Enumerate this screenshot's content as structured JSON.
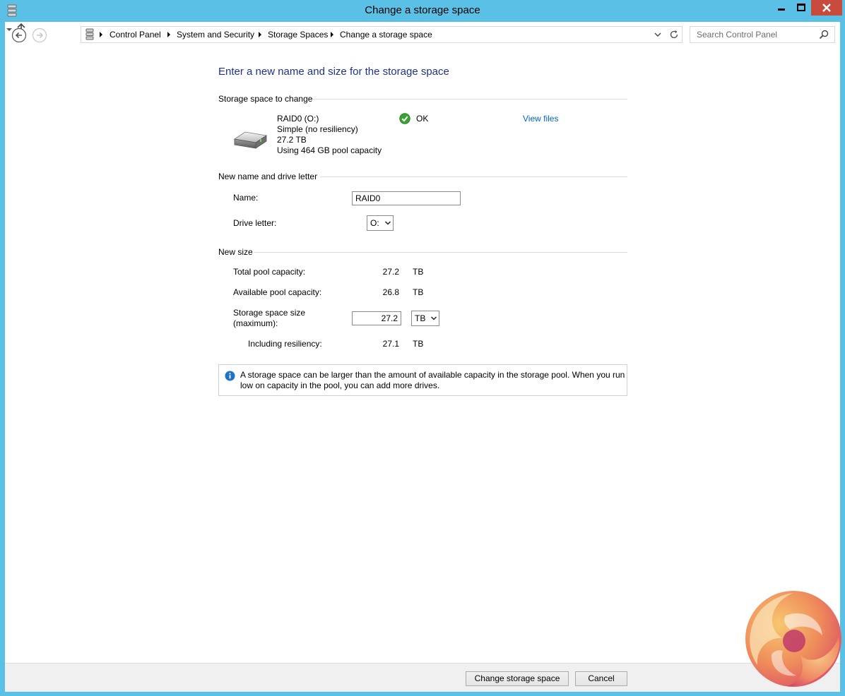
{
  "window": {
    "title": "Change a storage space"
  },
  "nav": {
    "breadcrumbs": [
      "Control Panel",
      "System and Security",
      "Storage Spaces",
      "Change a storage space"
    ],
    "search_placeholder": "Search Control Panel"
  },
  "page": {
    "heading": "Enter a new name and size for the storage space",
    "sections": {
      "space_to_change": "Storage space to change",
      "name_and_letter": "New name and drive letter",
      "new_size": "New size"
    },
    "space": {
      "name": "RAID0 (O:)",
      "type": "Simple (no resiliency)",
      "size": "27.2 TB",
      "usage": "Using 464 GB pool capacity",
      "status": "OK",
      "view_files": "View files"
    },
    "form": {
      "name_label": "Name:",
      "name_value": "RAID0",
      "drive_letter_label": "Drive letter:",
      "drive_letter_value": "O:",
      "total_label": "Total pool capacity:",
      "total_value": "27.2",
      "total_unit": "TB",
      "available_label": "Available pool capacity:",
      "available_value": "26.8",
      "available_unit": "TB",
      "size_label_1": "Storage space size",
      "size_label_2": "(maximum):",
      "size_value": "27.2",
      "size_unit": "TB",
      "resiliency_label": "Including resiliency:",
      "resiliency_value": "27.1",
      "resiliency_unit": "TB"
    },
    "info": "A storage space can be larger than the amount of available capacity in the storage pool. When you run low on capacity in the pool, you can add more drives."
  },
  "buttons": {
    "change": "Change storage space",
    "cancel": "Cancel"
  },
  "colors": {
    "titlebar": "#5bc0e6",
    "close_button": "#c74a3d",
    "heading": "#1e3287",
    "link": "#0066cc",
    "ok_green": "#3aa335",
    "info_blue": "#1f73c7"
  }
}
